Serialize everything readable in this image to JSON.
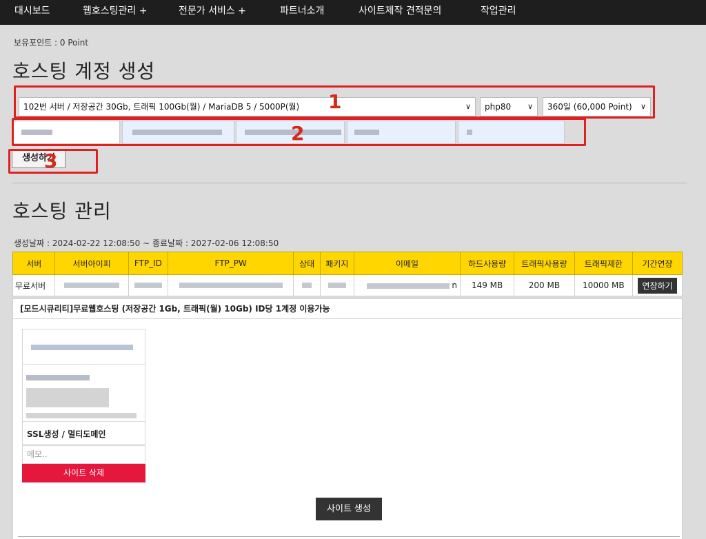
{
  "nav": {
    "items": [
      "대시보드",
      "웹호스팅관리 +",
      "전문가 서비스 +",
      "파트너소개",
      "사이트제작 견적문의",
      "작업관리"
    ]
  },
  "account": {
    "points_label": "보유포인트 : 0 Point"
  },
  "create_section": {
    "title": "호스팅 계정 생성",
    "server_select": "102번 서버 / 저장공간 30Gb, 트래픽 100Gb(월) / MariaDB 5 / 5000P(월)",
    "php_select": "php80",
    "period_select": "360일 (60,000 Point)",
    "create_button": "생성하기",
    "annotations": [
      "1",
      "2",
      "3"
    ]
  },
  "manage_section": {
    "title": "호스팅 관리",
    "date_line": "생성날짜 : 2024-02-22 12:08:50 ~ 종료날짜 : 2027-02-06 12:08:50",
    "columns": [
      "서버",
      "서버아이피",
      "FTP_ID",
      "FTP_PW",
      "상태",
      "패키지",
      "이메일",
      "하드사용량",
      "트래픽사용량",
      "트래픽제한",
      "기간연장"
    ],
    "row": {
      "server": "무료서버",
      "email_tail": "n",
      "disk_usage": "149 MB",
      "traffic_usage": "200 MB",
      "traffic_limit": "10000 MB",
      "extend_button": "연장하기"
    },
    "package_info": "[모드시큐리티]무료웹호스팅 (저장공간 1Gb, 트래픽(월) 10Gb) ID당 1계정 이용가능",
    "site_card": {
      "title": "SSL생성 / 멀티도메인",
      "memo_placeholder": "메모..",
      "delete_button": "사이트 삭제"
    },
    "create_site_button": "사이트 생성"
  },
  "colors": {
    "nav_bg": "#1e1e1e",
    "header_yellow": "#ffd600",
    "delete_red": "#e5173d",
    "annotation_red": "#e02020"
  }
}
